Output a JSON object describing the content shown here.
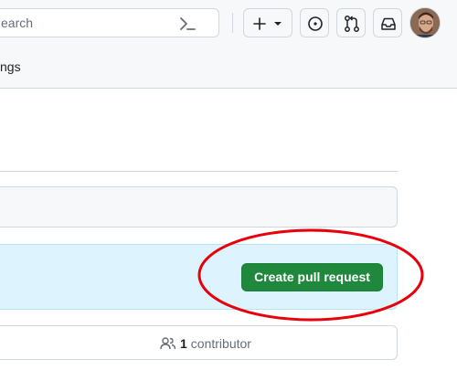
{
  "header": {
    "search_placeholder": "earch",
    "tab_partial": "ngs",
    "icons": [
      "command-palette-icon",
      "plus-icon",
      "chevron-down-icon",
      "issues-icon",
      "pull-requests-icon",
      "inbox-icon"
    ]
  },
  "compare": {
    "create_pr_label": "Create pull request",
    "button_color": "#1f883d",
    "banner_color": "#ddf4ff",
    "highlight_color": "#e8000b"
  },
  "footer": {
    "contributor_count": "1",
    "contributor_label": "contributor"
  }
}
